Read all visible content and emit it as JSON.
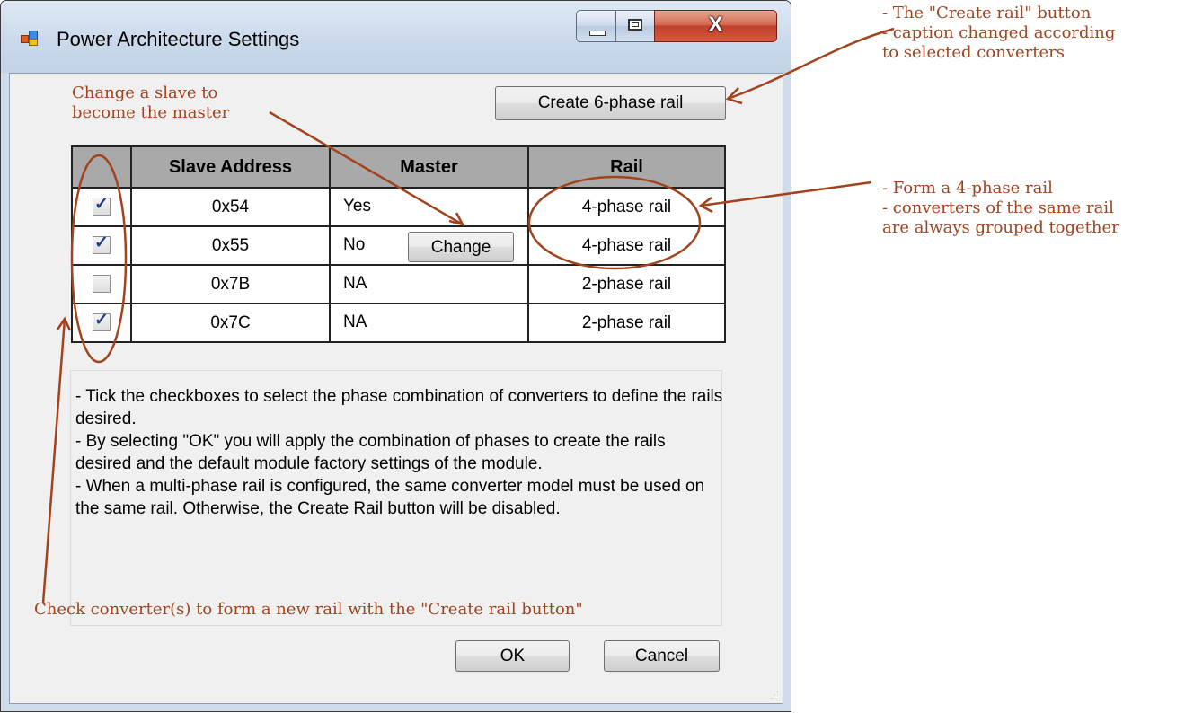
{
  "window": {
    "title": "Power Architecture Settings",
    "close_glyph": "X"
  },
  "toolbar": {
    "create_rail_label": "Create 6-phase rail"
  },
  "grid": {
    "headers": [
      "",
      "Slave Address",
      "Master",
      "Rail"
    ],
    "rows": [
      {
        "checked": true,
        "address": "0x54",
        "master": "Yes",
        "rail": "4-phase rail"
      },
      {
        "checked": true,
        "address": "0x55",
        "master": "No",
        "rail": "4-phase rail"
      },
      {
        "checked": false,
        "address": "0x7B",
        "master": "NA",
        "rail": "2-phase rail"
      },
      {
        "checked": true,
        "address": "0x7C",
        "master": "NA",
        "rail": "2-phase rail"
      }
    ],
    "change_label": "Change"
  },
  "info": {
    "text": "- Tick the checkboxes to select the phase combination of converters to define the rails desired.\n- By selecting \"OK\" you will apply the combination of phases to create the rails desired and the default module factory settings of the module.\n- When a multi-phase rail is configured, the same converter model must be used on the same rail. Otherwise, the Create Rail button will be disabled."
  },
  "dialog": {
    "ok_label": "OK",
    "cancel_label": "Cancel"
  },
  "annotations": {
    "slave_master": "Change a slave to\nbecome the master",
    "check_converters": "Check converter(s) to form a new rail with the \"Create rail button\"",
    "create_rail_note": "- The \"Create rail\" button\n- caption changed according\nto selected converters",
    "four_phase_note": "- Form a 4-phase rail\n- converters of the same rail\nare always grouped together"
  },
  "colors": {
    "annotation": "#a1441e",
    "header_bg": "#a9a9a9",
    "checkbox_tick": "#21408c"
  },
  "icons": [
    "app-icon",
    "minimize-icon",
    "maximize-icon",
    "close-icon",
    "checkbox-checked-icon",
    "checkbox-unchecked-icon",
    "size-grip-icon"
  ]
}
